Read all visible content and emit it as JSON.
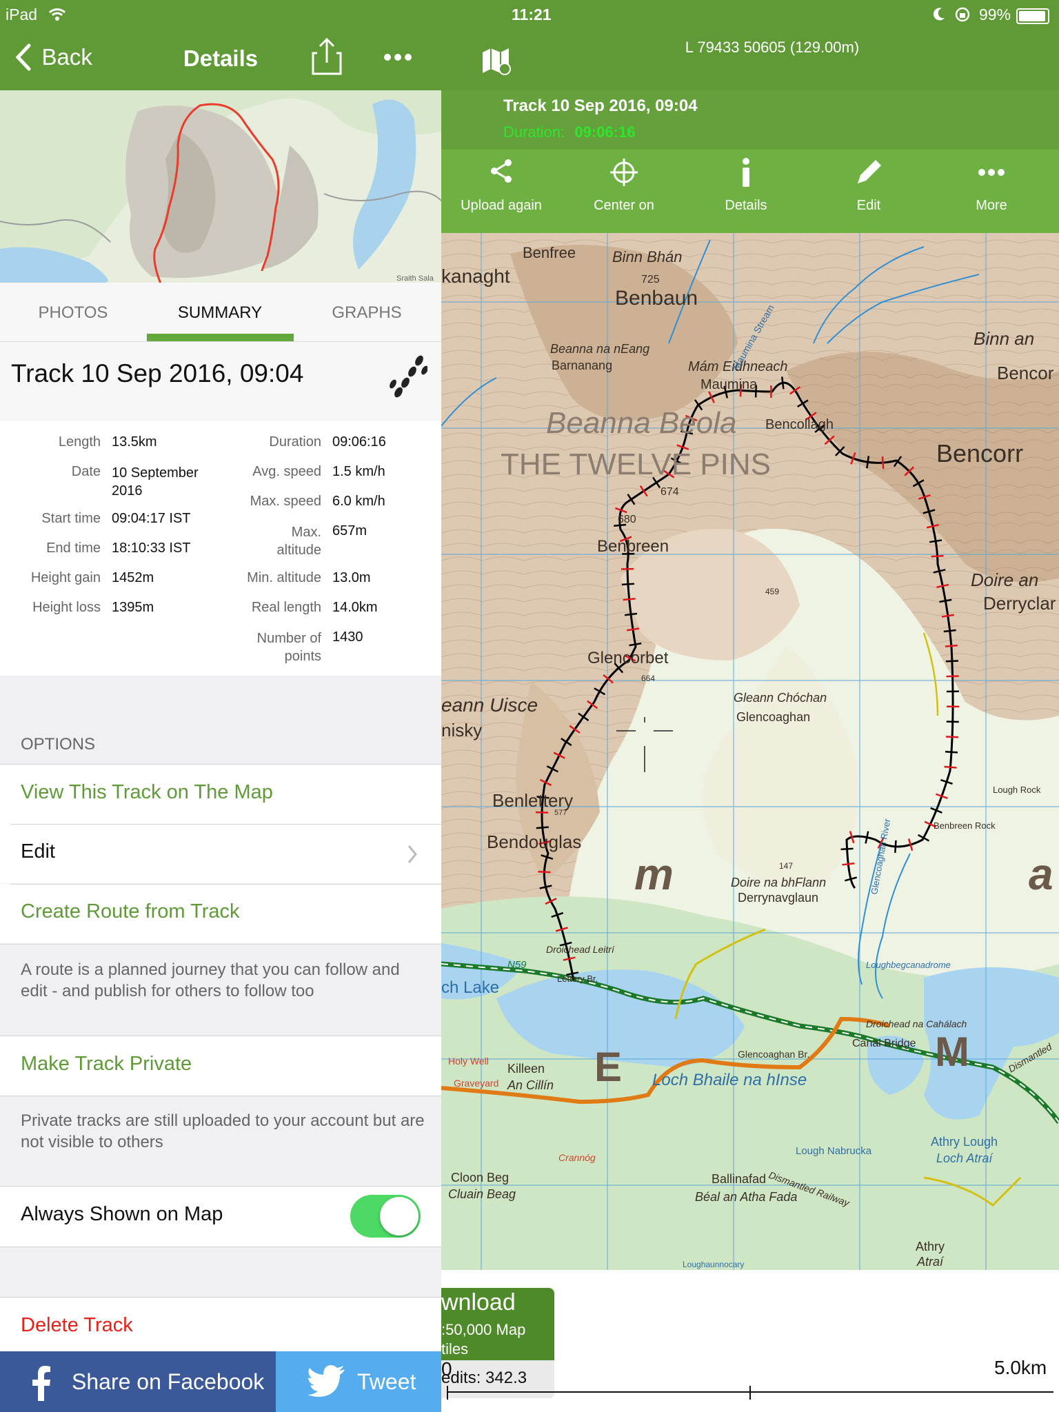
{
  "status_bar": {
    "device": "iPad",
    "time": "11:21",
    "battery": "99%"
  },
  "nav": {
    "back_label": "Back",
    "title": "Details"
  },
  "coordinates": "L 79433 50605  (129.00m)",
  "track_header": {
    "name": "Track 10 Sep 2016, 09:04",
    "duration_label": "Duration:",
    "duration_value": "09:06:16"
  },
  "actions": [
    {
      "label": "Upload again",
      "icon": "share-icon"
    },
    {
      "label": "Center on",
      "icon": "crosshair-icon"
    },
    {
      "label": "Details",
      "icon": "info-icon"
    },
    {
      "label": "Edit",
      "icon": "pencil-icon"
    },
    {
      "label": "More",
      "icon": "more-icon"
    }
  ],
  "thumbnail": {
    "place_label": "Sraith Sala"
  },
  "tabs": [
    "PHOTOS",
    "SUMMARY",
    "GRAPHS"
  ],
  "active_tab": "SUMMARY",
  "track_title": "Track 10 Sep 2016, 09:04",
  "stats_left": [
    {
      "label": "Length",
      "value": "13.5km"
    },
    {
      "label": "Date",
      "value": "10 September 2016"
    },
    {
      "label": "Start time",
      "value": "09:04:17 IST"
    },
    {
      "label": "End time",
      "value": "18:10:33 IST"
    },
    {
      "label": "Height gain",
      "value": "1452m"
    },
    {
      "label": "Height loss",
      "value": "1395m"
    }
  ],
  "stats_right": [
    {
      "label": "Duration",
      "value": "09:06:16"
    },
    {
      "label": "Avg. speed",
      "value": "1.5 km/h"
    },
    {
      "label": "Max. speed",
      "value": "6.0 km/h"
    },
    {
      "label": "Max. altitude",
      "value": "657m"
    },
    {
      "label": "Min. altitude",
      "value": "13.0m"
    },
    {
      "label": "Real length",
      "value": "14.0km"
    },
    {
      "label": "Number of points",
      "value": "1430"
    }
  ],
  "options": {
    "header": "OPTIONS",
    "view_on_map": "View This Track on The Map",
    "edit": "Edit",
    "create_route": "Create Route from Track",
    "route_note": "A route is a planned journey that you can follow and edit - and publish for others to follow too",
    "make_private": "Make Track Private",
    "private_note": "Private tracks are still uploaded to your account but are not visible to others",
    "always_shown": "Always Shown on Map",
    "always_shown_on": true,
    "delete": "Delete Track"
  },
  "share": {
    "facebook": "Share on Facebook",
    "twitter": "Tweet"
  },
  "map_labels": [
    "Benfree",
    "Binn Bhán",
    "725",
    "Benbaun",
    "kanaght",
    "Beanna na nEang",
    "Barnanang",
    "Mám Eidhneach",
    "Maumina",
    "Bencollagh",
    "Binn an",
    "Bencor",
    "Beanna Beola",
    "THE TWELVE PINS",
    "674",
    "680",
    "Bencorr",
    "Benbreen",
    "459",
    "Doire an",
    "Derryclar",
    "Glencorbet",
    "664",
    "eann Uisce",
    "nisky",
    "Gleann Chóchan",
    "Glencoaghan",
    "Benlettery",
    "577",
    "Bendouglas",
    "147",
    "Doire na bhFlann",
    "Derrynavglaun",
    "m",
    "a",
    "Lough Rock",
    "Benbreen Rock",
    "Droichead Leitrí",
    "Lettery Br.",
    "N59",
    "ch Lake",
    "Holy Well",
    "Graveyard",
    "Killeen",
    "An Cillín",
    "E",
    "Loch Bhaile na hInse",
    "Glencoaghan Br.",
    "Droichead na Cahálach",
    "Canal Bridge",
    "M",
    "Loughbegcanadrome",
    "Dismantled",
    "Lough Nabrucka",
    "Ballinafad",
    "Béal an Atha Fada",
    "Cloon Beg",
    "Cluain Beag",
    "Crannóg",
    "Athry Lough",
    "Loch Atraí",
    "Athry",
    "Atraí",
    "Glencoaghan River",
    "Maumina Stream",
    "Dismantled Railway",
    "Loughaunnocary"
  ],
  "download_badge": {
    "title": "wnload",
    "subtitle": ":50,000 Map",
    "subtitle2": "tiles",
    "credits": "edits: 342.3"
  },
  "scale": {
    "start": "0",
    "end": "5.0km"
  },
  "colors": {
    "brand_green": "#5f9a37",
    "track_line": "#000000",
    "track_markers": "#e0161b",
    "road_green": "#1b7a2a",
    "road_orange": "#e07a14",
    "delete_red": "#e8201a"
  }
}
